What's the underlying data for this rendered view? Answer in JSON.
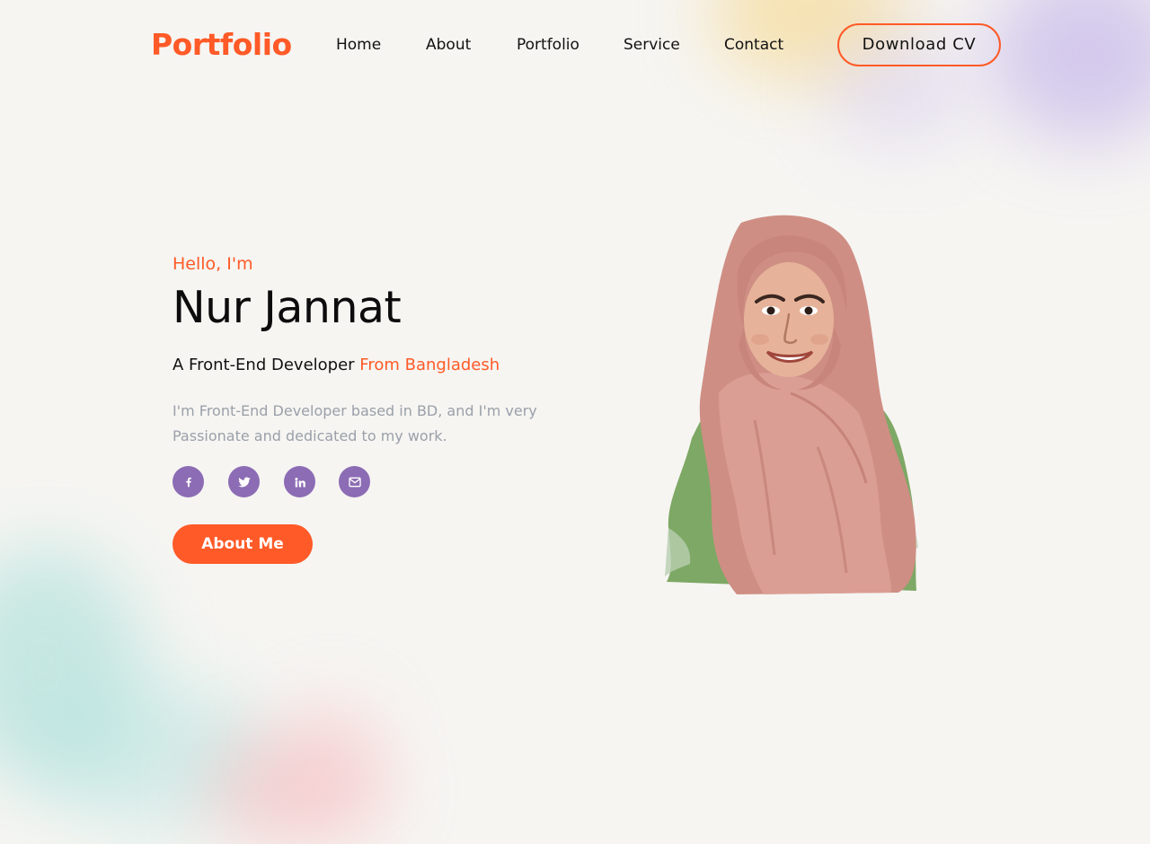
{
  "header": {
    "logo": "Portfolio",
    "nav": [
      "Home",
      "About",
      "Portfolio",
      "Service",
      "Contact"
    ],
    "cta_label": "Download CV"
  },
  "hero": {
    "greeting": "Hello, I'm",
    "name": "Nur Jannat",
    "role_prefix": "A Front-End Developer",
    "role_accent": "From Bangladesh",
    "bio": "I'm Front-End Developer based in BD, and I'm very Passionate and dedicated to my work.",
    "button_label": "About Me"
  },
  "social": [
    {
      "icon": "facebook-icon"
    },
    {
      "icon": "twitter-icon"
    },
    {
      "icon": "linkedin-icon"
    },
    {
      "icon": "mail-icon"
    }
  ],
  "colors": {
    "accent": "#ff5a27",
    "social_bg": "#8c6cb4",
    "text": "#111111",
    "muted": "#9aa0a9",
    "background": "#f6f5f2"
  }
}
